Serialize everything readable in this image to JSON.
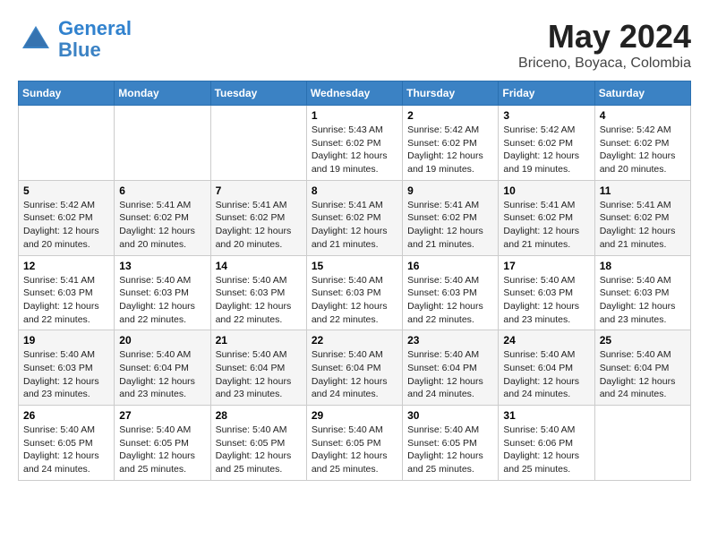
{
  "logo": {
    "line1": "General",
    "line2": "Blue"
  },
  "title": "May 2024",
  "subtitle": "Briceno, Boyaca, Colombia",
  "weekdays": [
    "Sunday",
    "Monday",
    "Tuesday",
    "Wednesday",
    "Thursday",
    "Friday",
    "Saturday"
  ],
  "weeks": [
    [
      {
        "day": "",
        "info": ""
      },
      {
        "day": "",
        "info": ""
      },
      {
        "day": "",
        "info": ""
      },
      {
        "day": "1",
        "info": "Sunrise: 5:43 AM\nSunset: 6:02 PM\nDaylight: 12 hours\nand 19 minutes."
      },
      {
        "day": "2",
        "info": "Sunrise: 5:42 AM\nSunset: 6:02 PM\nDaylight: 12 hours\nand 19 minutes."
      },
      {
        "day": "3",
        "info": "Sunrise: 5:42 AM\nSunset: 6:02 PM\nDaylight: 12 hours\nand 19 minutes."
      },
      {
        "day": "4",
        "info": "Sunrise: 5:42 AM\nSunset: 6:02 PM\nDaylight: 12 hours\nand 20 minutes."
      }
    ],
    [
      {
        "day": "5",
        "info": "Sunrise: 5:42 AM\nSunset: 6:02 PM\nDaylight: 12 hours\nand 20 minutes."
      },
      {
        "day": "6",
        "info": "Sunrise: 5:41 AM\nSunset: 6:02 PM\nDaylight: 12 hours\nand 20 minutes."
      },
      {
        "day": "7",
        "info": "Sunrise: 5:41 AM\nSunset: 6:02 PM\nDaylight: 12 hours\nand 20 minutes."
      },
      {
        "day": "8",
        "info": "Sunrise: 5:41 AM\nSunset: 6:02 PM\nDaylight: 12 hours\nand 21 minutes."
      },
      {
        "day": "9",
        "info": "Sunrise: 5:41 AM\nSunset: 6:02 PM\nDaylight: 12 hours\nand 21 minutes."
      },
      {
        "day": "10",
        "info": "Sunrise: 5:41 AM\nSunset: 6:02 PM\nDaylight: 12 hours\nand 21 minutes."
      },
      {
        "day": "11",
        "info": "Sunrise: 5:41 AM\nSunset: 6:02 PM\nDaylight: 12 hours\nand 21 minutes."
      }
    ],
    [
      {
        "day": "12",
        "info": "Sunrise: 5:41 AM\nSunset: 6:03 PM\nDaylight: 12 hours\nand 22 minutes."
      },
      {
        "day": "13",
        "info": "Sunrise: 5:40 AM\nSunset: 6:03 PM\nDaylight: 12 hours\nand 22 minutes."
      },
      {
        "day": "14",
        "info": "Sunrise: 5:40 AM\nSunset: 6:03 PM\nDaylight: 12 hours\nand 22 minutes."
      },
      {
        "day": "15",
        "info": "Sunrise: 5:40 AM\nSunset: 6:03 PM\nDaylight: 12 hours\nand 22 minutes."
      },
      {
        "day": "16",
        "info": "Sunrise: 5:40 AM\nSunset: 6:03 PM\nDaylight: 12 hours\nand 22 minutes."
      },
      {
        "day": "17",
        "info": "Sunrise: 5:40 AM\nSunset: 6:03 PM\nDaylight: 12 hours\nand 23 minutes."
      },
      {
        "day": "18",
        "info": "Sunrise: 5:40 AM\nSunset: 6:03 PM\nDaylight: 12 hours\nand 23 minutes."
      }
    ],
    [
      {
        "day": "19",
        "info": "Sunrise: 5:40 AM\nSunset: 6:03 PM\nDaylight: 12 hours\nand 23 minutes."
      },
      {
        "day": "20",
        "info": "Sunrise: 5:40 AM\nSunset: 6:04 PM\nDaylight: 12 hours\nand 23 minutes."
      },
      {
        "day": "21",
        "info": "Sunrise: 5:40 AM\nSunset: 6:04 PM\nDaylight: 12 hours\nand 23 minutes."
      },
      {
        "day": "22",
        "info": "Sunrise: 5:40 AM\nSunset: 6:04 PM\nDaylight: 12 hours\nand 24 minutes."
      },
      {
        "day": "23",
        "info": "Sunrise: 5:40 AM\nSunset: 6:04 PM\nDaylight: 12 hours\nand 24 minutes."
      },
      {
        "day": "24",
        "info": "Sunrise: 5:40 AM\nSunset: 6:04 PM\nDaylight: 12 hours\nand 24 minutes."
      },
      {
        "day": "25",
        "info": "Sunrise: 5:40 AM\nSunset: 6:04 PM\nDaylight: 12 hours\nand 24 minutes."
      }
    ],
    [
      {
        "day": "26",
        "info": "Sunrise: 5:40 AM\nSunset: 6:05 PM\nDaylight: 12 hours\nand 24 minutes."
      },
      {
        "day": "27",
        "info": "Sunrise: 5:40 AM\nSunset: 6:05 PM\nDaylight: 12 hours\nand 25 minutes."
      },
      {
        "day": "28",
        "info": "Sunrise: 5:40 AM\nSunset: 6:05 PM\nDaylight: 12 hours\nand 25 minutes."
      },
      {
        "day": "29",
        "info": "Sunrise: 5:40 AM\nSunset: 6:05 PM\nDaylight: 12 hours\nand 25 minutes."
      },
      {
        "day": "30",
        "info": "Sunrise: 5:40 AM\nSunset: 6:05 PM\nDaylight: 12 hours\nand 25 minutes."
      },
      {
        "day": "31",
        "info": "Sunrise: 5:40 AM\nSunset: 6:06 PM\nDaylight: 12 hours\nand 25 minutes."
      },
      {
        "day": "",
        "info": ""
      }
    ]
  ]
}
